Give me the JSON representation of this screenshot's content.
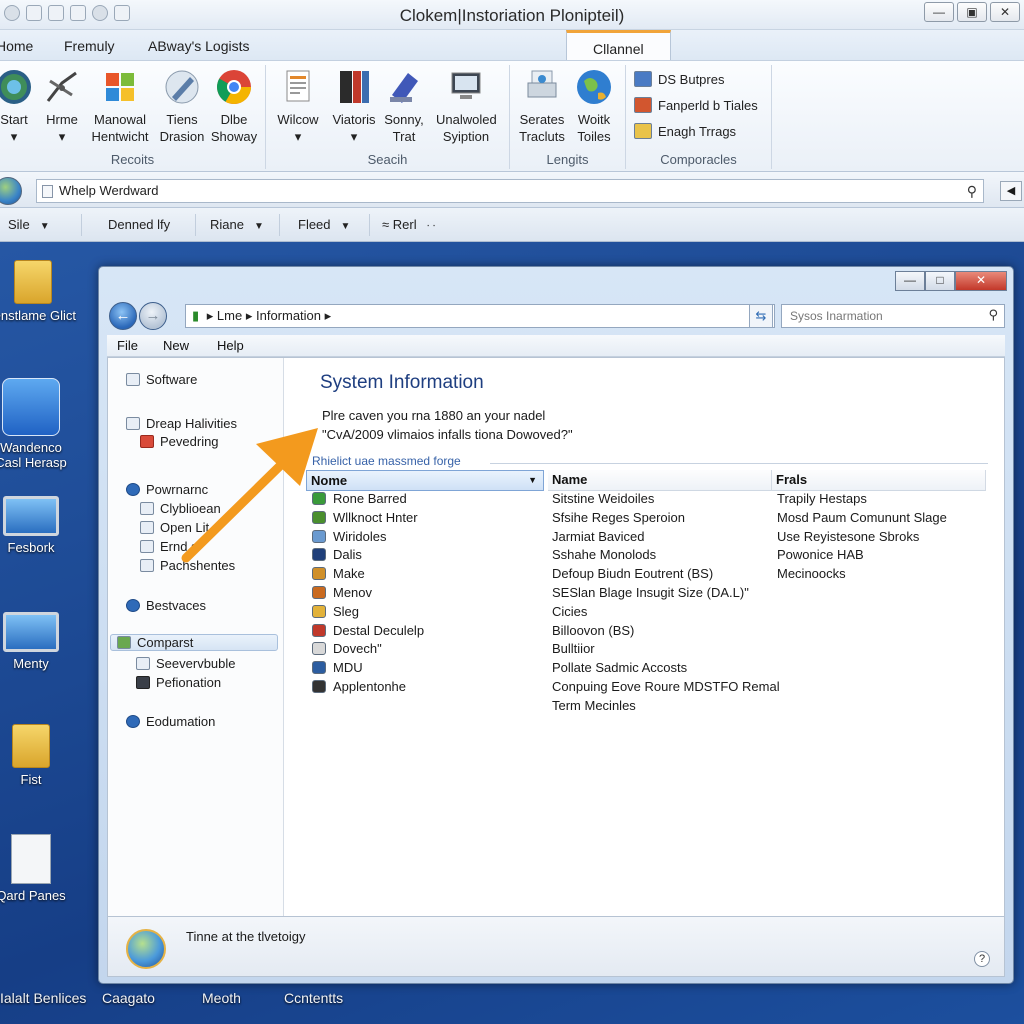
{
  "app": {
    "title": "Clokem|Instoriation Plonipteil)",
    "tabs": [
      "Home",
      "Fremuly",
      "ABway's Logists",
      "Cllannel"
    ]
  },
  "ribbon": {
    "groups": [
      {
        "label": "Recoits",
        "buttons": [
          {
            "line1": "Start",
            "line2": "▾",
            "icon": "gear-globe-icon"
          },
          {
            "line1": "Hrme",
            "line2": "▾",
            "icon": "satellite-dish-icon"
          },
          {
            "line1": "Manowal",
            "line2": "Hentwicht",
            "icon": "windows-logo-icon"
          },
          {
            "line1": "Tiens",
            "line2": "Drasion",
            "icon": "pen-icon"
          },
          {
            "line1": "Dlbe",
            "line2": "Showay",
            "icon": "chrome-icon"
          }
        ]
      },
      {
        "label": "Seacih",
        "buttons": [
          {
            "line1": "Wilcow",
            "line2": "▾",
            "icon": "document-icon"
          },
          {
            "line1": "Viatoris",
            "line2": "▾",
            "icon": "books-icon"
          },
          {
            "line1": "Sonny,",
            "line2": "Trat",
            "icon": "stamp-icon"
          },
          {
            "line1": "Unalwoled",
            "line2": "Syiption",
            "icon": "monitor-icon"
          }
        ]
      },
      {
        "label": "Lengits",
        "buttons": [
          {
            "line1": "Serates",
            "line2": "Tracluts",
            "icon": "printer-icon"
          },
          {
            "line1": "Woitk",
            "line2": "Toiles",
            "icon": "earth-icon"
          }
        ]
      },
      {
        "label": "Comporacles",
        "items": [
          "DS Butpres",
          "Fanperld b Tiales",
          "Enagh Trrags"
        ]
      }
    ]
  },
  "address": {
    "value": "Whelp Werdward"
  },
  "filters": [
    "Sile",
    "Denned lfy",
    "Riane",
    "Fleed",
    "≈ Rerl"
  ],
  "desktop_icons": [
    "Ienstlame Glict",
    "Wandenco\nCasl Herasp",
    "Fesbork",
    "Menty",
    "Fist",
    "Qard Panes"
  ],
  "taskbar": [
    "Ialalt Benlices",
    "Caagato",
    "Meoth",
    "Ccntentts"
  ],
  "window": {
    "breadcrumb": [
      "Lme",
      "Information"
    ],
    "search_placeholder": "Sysos Inarmation",
    "menu": [
      "File",
      "New",
      "Help"
    ],
    "tree": [
      {
        "label": "Software",
        "indent": 0
      },
      {
        "label": "Dreap Halivities",
        "indent": 0
      },
      {
        "label": "Pevedring",
        "indent": 1
      },
      {
        "label": "Powrnarnc",
        "indent": 0
      },
      {
        "label": "Clyblioean",
        "indent": 1
      },
      {
        "label": "Open Lit",
        "indent": 1
      },
      {
        "label": "Ernd s",
        "indent": 1
      },
      {
        "label": "Pachshentes",
        "indent": 1
      },
      {
        "label": "Bestvaces",
        "indent": 0
      },
      {
        "label": "Comparst",
        "indent": 0,
        "selected": true
      },
      {
        "label": "Seevervbuble",
        "indent": 1
      },
      {
        "label": "Pefionation",
        "indent": 1
      },
      {
        "label": "Eodumation",
        "indent": 0
      }
    ],
    "heading": "System Information",
    "description": "Plre caven you rna 1880 an your nadel\n\"CvA/2009 vlimaios infalls tiona Dowoved?\"",
    "group_label": "Rhielict uae massmed forge",
    "columns": [
      "Nome",
      "Name",
      "Frals"
    ],
    "rows": [
      {
        "c1": "Rone Barred",
        "c2": "Sitstine Weidoiles",
        "c3": "Trapily Hestaps",
        "color": "#3a9a3a"
      },
      {
        "c1": "Wllknoct Hnter",
        "c2": "Sfsihe Reges Speroion",
        "c3": "Mosd Paum Comununt Slage",
        "color": "#4a8f2e"
      },
      {
        "c1": "Wiridoles",
        "c2": "Jarmiat Baviced",
        "c3": "Use Reyistesone Sbroks",
        "color": "#6a9ad0"
      },
      {
        "c1": "Dalis",
        "c2": "Sshahe Monolods",
        "c3": "Powonice HAB",
        "color": "#1f3f7a"
      },
      {
        "c1": "Make",
        "c2": "Defoup Biudn Eoutrent (BS)",
        "c3": "Mecinoocks",
        "color": "#d0902a"
      },
      {
        "c1": "Menov",
        "c2": "SESlan Blage Insugit Size (DA.L)\"",
        "c3": "",
        "color": "#c96a20"
      },
      {
        "c1": "Sleg",
        "c2": "Cicies",
        "c3": "",
        "color": "#e2b23a"
      },
      {
        "c1": "Destal Deculelp",
        "c2": "Billoovon (BS)",
        "c3": "",
        "color": "#c0392b"
      },
      {
        "c1": "Dovech\"",
        "c2": "Bulltiior",
        "c3": "",
        "color": "#d8d8d8"
      },
      {
        "c1": "MDU",
        "c2": "Pollate Sadmic Accosts",
        "c3": "",
        "color": "#2c5da0"
      },
      {
        "c1": "Applentonhe",
        "c2": "Conpuing Eove Roure MDSTFO Remal",
        "c3": "",
        "color": "#333333"
      },
      {
        "c1": "",
        "c2": "Term Mecinles",
        "c3": "",
        "color": ""
      }
    ],
    "status_text": "Tinne at the tlvetoigy"
  },
  "colors": {
    "desktop": "#1f4d98",
    "accent_tab": "#f1a43a",
    "heading": "#1e3e80",
    "arrow": "#f39a1e",
    "close_button": "#c2382a"
  }
}
